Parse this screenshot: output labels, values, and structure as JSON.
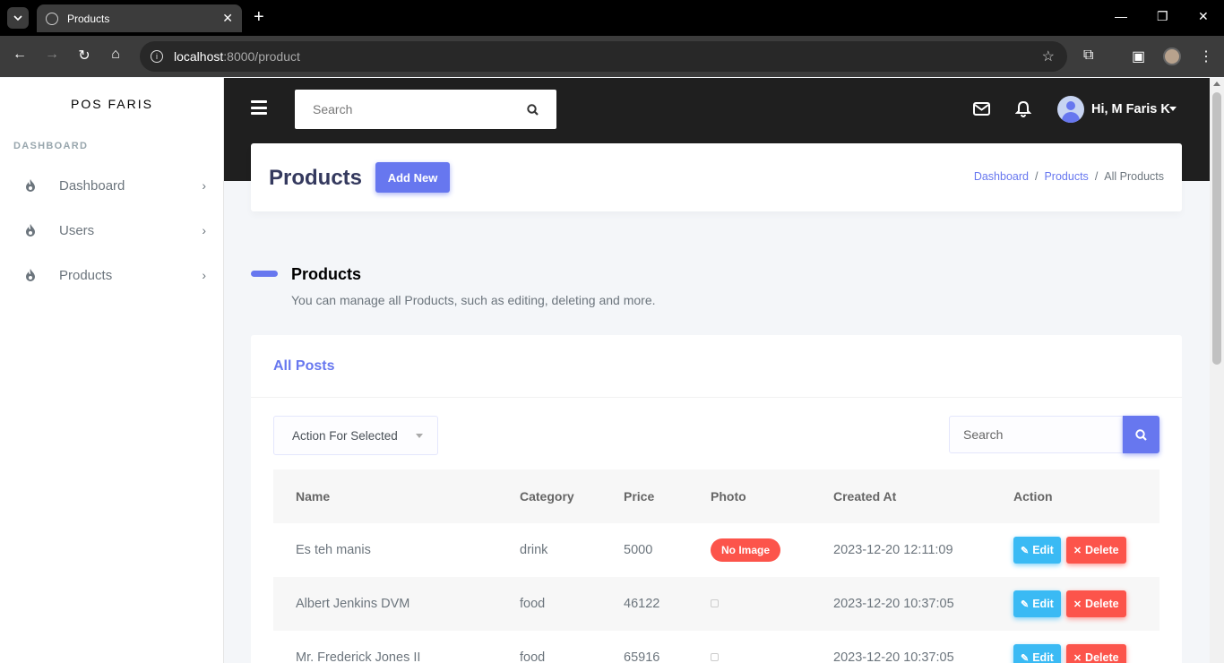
{
  "browser": {
    "tab_title": "Products",
    "url_host": "localhost",
    "url_path": ":8000/product"
  },
  "sidebar": {
    "brand": "POS FARIS",
    "menu_header": "DASHBOARD",
    "items": [
      {
        "label": "Dashboard"
      },
      {
        "label": "Users"
      },
      {
        "label": "Products"
      }
    ]
  },
  "navbar": {
    "search_placeholder": "Search",
    "user_name": "Hi, M Faris K"
  },
  "header": {
    "title": "Products",
    "add_new_label": "Add New",
    "breadcrumb": [
      "Dashboard",
      "Products",
      "All Products"
    ]
  },
  "section": {
    "title": "Products",
    "lead": "You can manage all Products, such as editing, deleting and more."
  },
  "card": {
    "title": "All Posts",
    "bulk_action": "Action For Selected",
    "search_placeholder": "Search"
  },
  "table": {
    "columns": [
      "Name",
      "Category",
      "Price",
      "Photo",
      "Created At",
      "Action"
    ],
    "rows": [
      {
        "name": "Es teh manis",
        "category": "drink",
        "price": "5000",
        "photo": "No Image",
        "created_at": "2023-12-20 12:11:09"
      },
      {
        "name": "Albert Jenkins DVM",
        "category": "food",
        "price": "46122",
        "photo": "",
        "created_at": "2023-12-20 10:37:05"
      },
      {
        "name": "Mr. Frederick Jones II",
        "category": "food",
        "price": "65916",
        "photo": "",
        "created_at": "2023-12-20 10:37:05"
      }
    ],
    "edit_label": "Edit",
    "delete_label": "Delete"
  },
  "colors": {
    "primary": "#6777ef",
    "danger": "#fc544b",
    "info": "#3abaf4",
    "navbar": "#1f1f1f"
  }
}
